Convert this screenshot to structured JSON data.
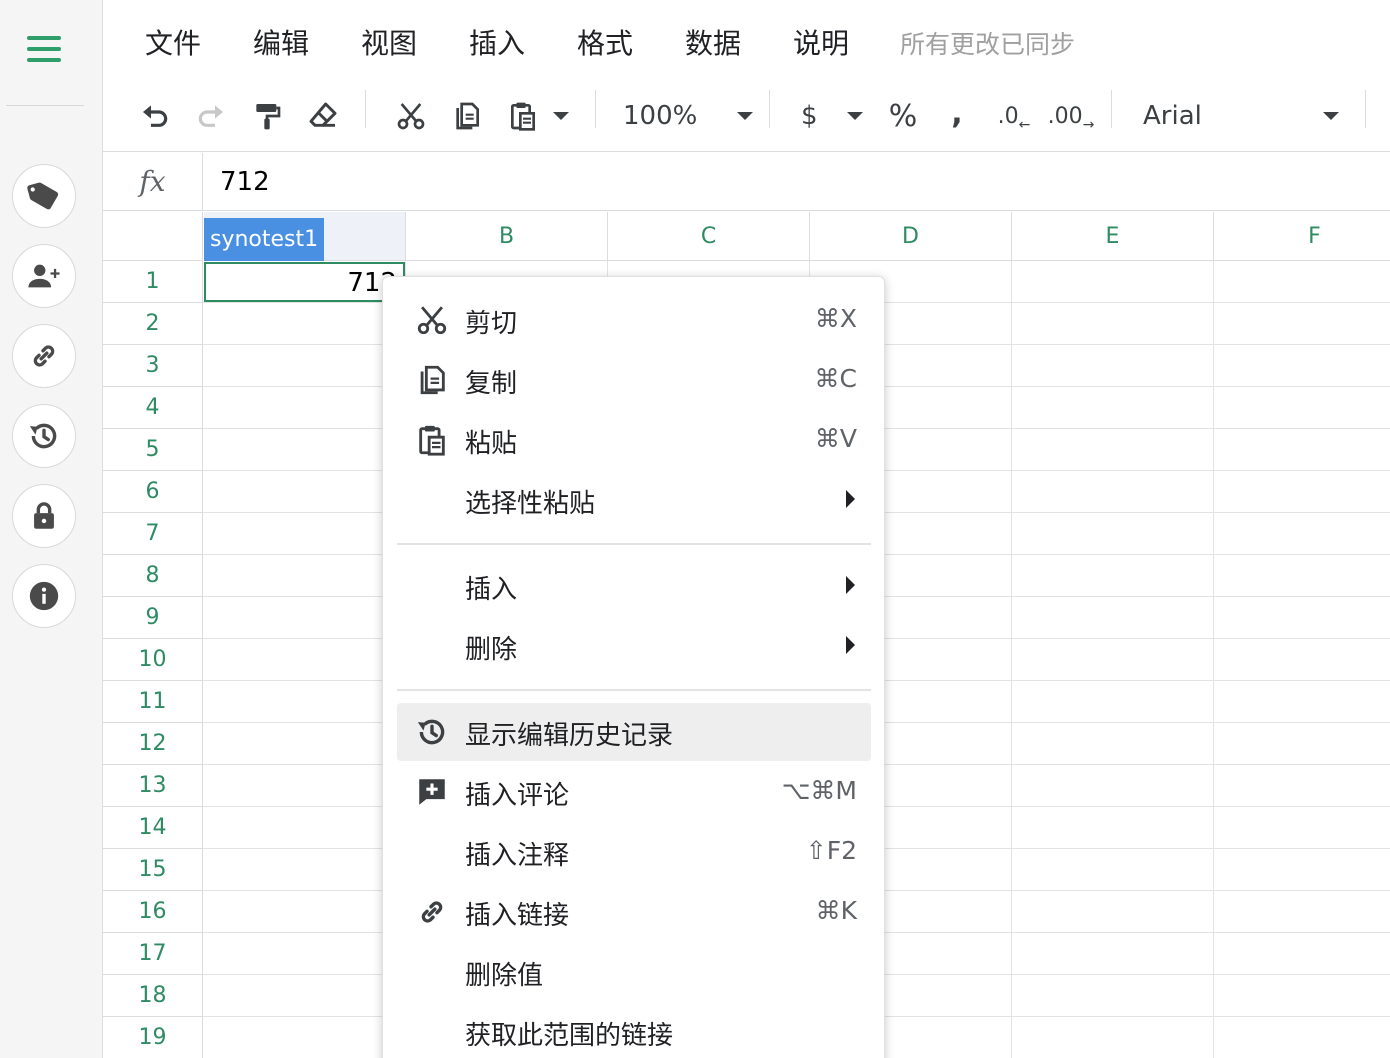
{
  "menubar": {
    "items": [
      "文件",
      "编辑",
      "视图",
      "插入",
      "格式",
      "数据",
      "说明"
    ],
    "sync_status": "所有更改已同步"
  },
  "toolbar": {
    "zoom": "100%",
    "currency": "$",
    "percent": "%",
    "comma": ",",
    "decrease_decimal": ".0",
    "increase_decimal": ".00",
    "font": "Arial"
  },
  "formula_bar": {
    "label": "fx",
    "value": "712"
  },
  "grid": {
    "col_a_label": "synotest1",
    "columns": [
      "B",
      "C",
      "D",
      "E",
      "F"
    ],
    "rows": [
      "1",
      "2",
      "3",
      "4",
      "5",
      "6",
      "7",
      "8",
      "9",
      "10",
      "11",
      "12",
      "13",
      "14",
      "15",
      "16",
      "17",
      "18",
      "19"
    ],
    "active_cell_value": "712"
  },
  "context_menu": {
    "items": [
      {
        "label": "剪切",
        "shortcut": "⌘X",
        "icon": "scissors-icon"
      },
      {
        "label": "复制",
        "shortcut": "⌘C",
        "icon": "copy-icon"
      },
      {
        "label": "粘贴",
        "shortcut": "⌘V",
        "icon": "paste-icon"
      },
      {
        "label": "选择性粘贴",
        "submenu": true
      },
      {
        "label": "插入",
        "submenu": true
      },
      {
        "label": "删除",
        "submenu": true
      },
      {
        "label": "显示编辑历史记录",
        "icon": "history-icon",
        "highlighted": true
      },
      {
        "label": "插入评论",
        "shortcut": "⌥⌘M",
        "icon": "add-comment-icon"
      },
      {
        "label": "插入注释",
        "shortcut": "⇧F2"
      },
      {
        "label": "插入链接",
        "shortcut": "⌘K",
        "icon": "link-icon"
      },
      {
        "label": "删除值"
      },
      {
        "label": "获取此范围的链接"
      }
    ]
  },
  "colors": {
    "accent_green": "#2e8b62",
    "header_blue": "#4a90e2",
    "menu_highlight": "#eeeeee"
  }
}
